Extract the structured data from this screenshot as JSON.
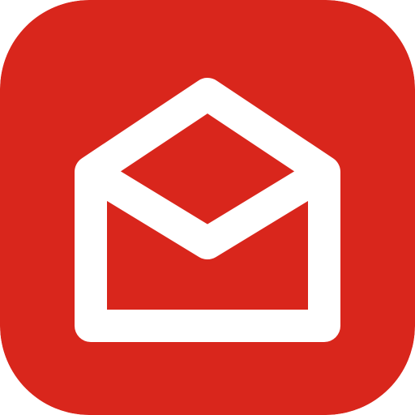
{
  "icon": {
    "name": "open-envelope-icon",
    "colors": {
      "background": "#D9261C",
      "glyph": "#FFFFFF"
    }
  }
}
